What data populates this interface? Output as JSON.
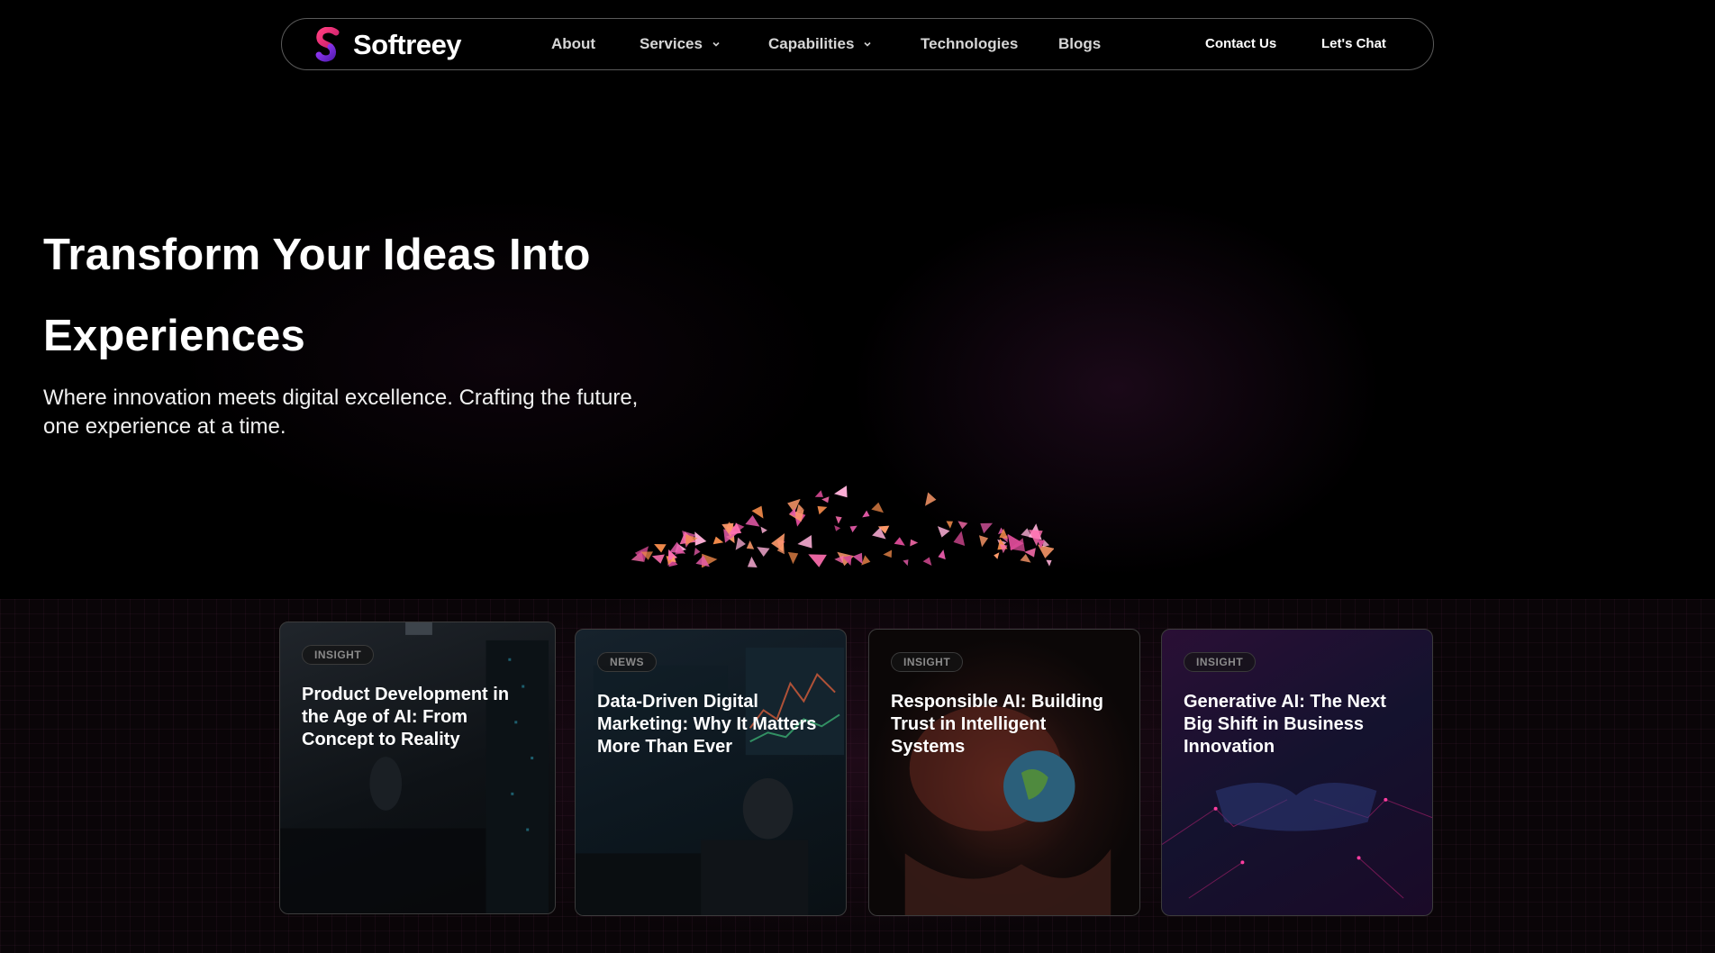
{
  "brand": {
    "name": "Softreey",
    "logo_icon": "swirl-s-logo",
    "accent_colors": [
      "#e0287a",
      "#7b2bd6"
    ]
  },
  "nav": {
    "items": [
      {
        "label": "About",
        "has_dropdown": false
      },
      {
        "label": "Services",
        "has_dropdown": true
      },
      {
        "label": "Capabilities",
        "has_dropdown": true
      },
      {
        "label": "Technologies",
        "has_dropdown": false
      },
      {
        "label": "Blogs",
        "has_dropdown": false
      }
    ],
    "contact_label": "Contact Us",
    "chat_label": "Let's Chat"
  },
  "hero": {
    "title_line1": "Transform Your Ideas Into",
    "title_line2": "Experiences",
    "subtitle_line1": "Where innovation meets digital excellence. Crafting the future,",
    "subtitle_line2": "one experience at a time."
  },
  "cards": [
    {
      "tag": "INSIGHT",
      "title": "Product Development in the Age of AI: From Concept to Reality"
    },
    {
      "tag": "NEWS",
      "title": "Data-Driven Digital Marketing: Why It Matters More Than Ever"
    },
    {
      "tag": "INSIGHT",
      "title": "Responsible AI: Building Trust in Intelligent Systems"
    },
    {
      "tag": "INSIGHT",
      "title": "Generative AI: The Next Big Shift in Business Innovation"
    }
  ]
}
